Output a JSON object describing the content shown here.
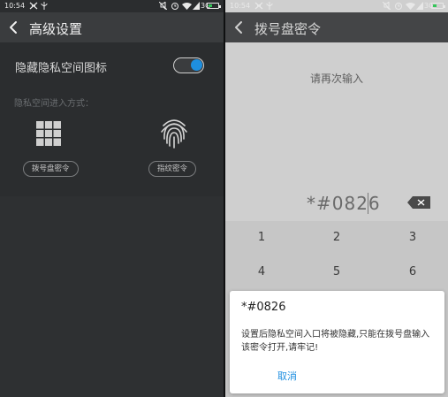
{
  "left": {
    "status": {
      "time": "10:54",
      "network": "3G"
    },
    "header": {
      "title": "高级设置"
    },
    "hide_toggle": {
      "label": "隐藏隐私空间图标",
      "on": true
    },
    "entry_hint": "隐私空间进入方式：",
    "entries": [
      {
        "label": "拨号盘密令",
        "icon": "dialpad-grid-icon"
      },
      {
        "label": "指纹密令",
        "icon": "fingerprint-icon"
      }
    ]
  },
  "right": {
    "status": {
      "time": "10:54",
      "network": "3G"
    },
    "header": {
      "title": "拨号盘密令"
    },
    "prompt": "请再次输入",
    "entered_code": "*#0826",
    "keypad": [
      "1",
      "2",
      "3",
      "4",
      "5",
      "6"
    ],
    "dialog": {
      "title": "*#0826",
      "message": "设置后隐私空间入口将被隐藏,只能在拨号盘输入该密令打开,请牢记!",
      "cancel_label": "取消"
    }
  },
  "colors": {
    "accent": "#1e8fe0",
    "dark_bg": "#2b2d2f",
    "battery": "#34c759"
  }
}
